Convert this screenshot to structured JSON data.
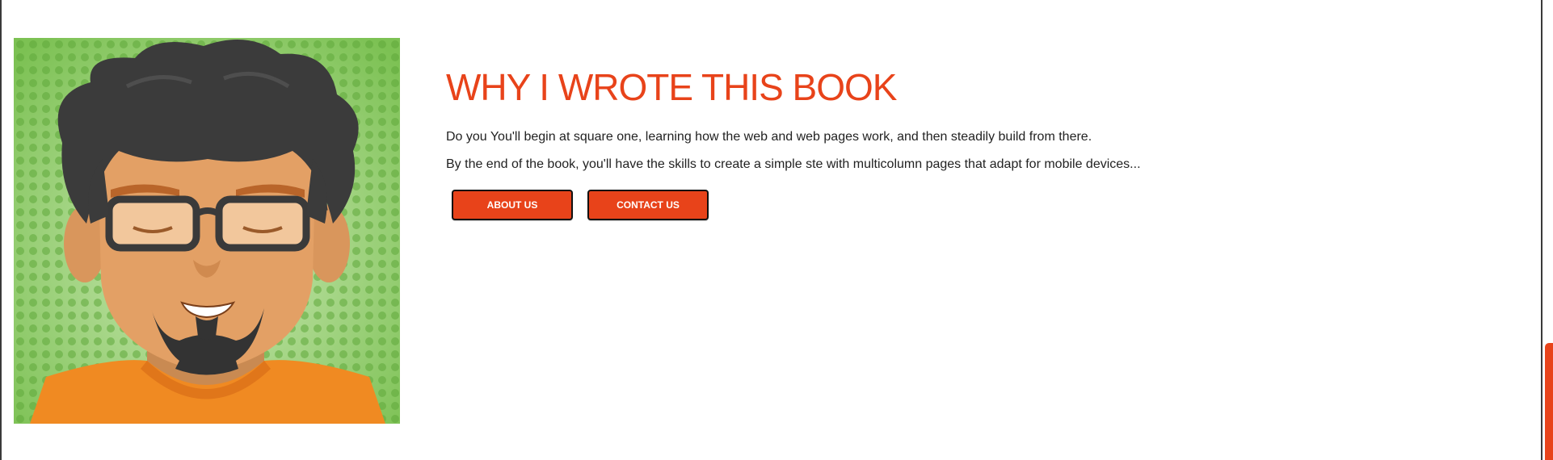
{
  "section": {
    "title": "WHY I WROTE THIS BOOK",
    "paragraphs": [
      "Do you You'll begin at square one, learning how the web and web pages work, and then steadily build from there.",
      "By the end of the book, you'll have the skills to create a simple ste with multicolumn pages that adapt for mobile devices..."
    ]
  },
  "buttons": {
    "about_label": "ABOUT US",
    "contact_label": "CONTACT US"
  },
  "avatar": {
    "icon": "cartoon-author-portrait"
  },
  "colors": {
    "accent": "#e8431a",
    "avatar_background": "#6fba4a",
    "text": "#222222"
  }
}
